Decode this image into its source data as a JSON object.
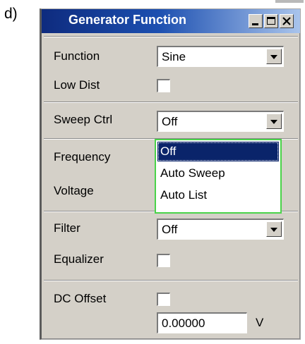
{
  "figure_label": "d)",
  "window": {
    "title": "Generator Function",
    "controls": {
      "minimize_icon": "minimize-icon",
      "maximize_icon": "maximize-icon",
      "close_icon": "close-icon"
    }
  },
  "rows": {
    "function": {
      "label": "Function",
      "value": "Sine"
    },
    "low_dist": {
      "label": "Low Dist",
      "checked": false
    },
    "sweep_ctrl": {
      "label": "Sweep Ctrl",
      "value": "Off"
    },
    "frequency": {
      "label": "Frequency"
    },
    "voltage": {
      "label": "Voltage"
    },
    "filter": {
      "label": "Filter",
      "value": "Off"
    },
    "equalizer": {
      "label": "Equalizer",
      "checked": false
    },
    "dc_offset": {
      "label": "DC Offset",
      "checked": false,
      "value": "0.00000",
      "unit": "V"
    }
  },
  "sweep_dropdown": {
    "options": [
      "Off",
      "Auto Sweep",
      "Auto List"
    ],
    "selected": "Off"
  },
  "colors": {
    "title_gradient_start": "#0e2b7e",
    "panel_bg": "#d4d0c8",
    "selection": "#0a246a",
    "dropdown_focus_border": "#4ad34a"
  }
}
